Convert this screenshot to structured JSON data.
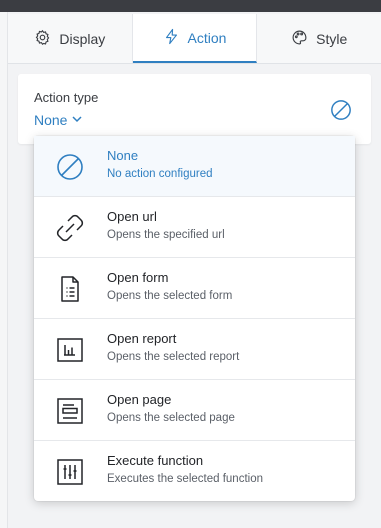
{
  "tabs": [
    {
      "label": "Display",
      "icon": "gear-icon",
      "active": false
    },
    {
      "label": "Action",
      "icon": "lightning-icon",
      "active": true
    },
    {
      "label": "Style",
      "icon": "palette-icon",
      "active": false
    }
  ],
  "action_type": {
    "label": "Action type",
    "value": "None",
    "icon": "no-action-icon"
  },
  "options": [
    {
      "title": "None",
      "description": "No action configured",
      "icon": "no-action-icon",
      "selected": true
    },
    {
      "title": "Open url",
      "description": "Opens the specified url",
      "icon": "link-icon",
      "selected": false
    },
    {
      "title": "Open form",
      "description": "Opens the selected form",
      "icon": "form-icon",
      "selected": false
    },
    {
      "title": "Open report",
      "description": "Opens the selected report",
      "icon": "report-icon",
      "selected": false
    },
    {
      "title": "Open page",
      "description": "Opens the selected page",
      "icon": "page-icon",
      "selected": false
    },
    {
      "title": "Execute function",
      "description": "Executes the selected function",
      "icon": "function-icon",
      "selected": false
    }
  ],
  "colors": {
    "accent": "#2f7fc1",
    "topbar": "#3b3d42"
  }
}
